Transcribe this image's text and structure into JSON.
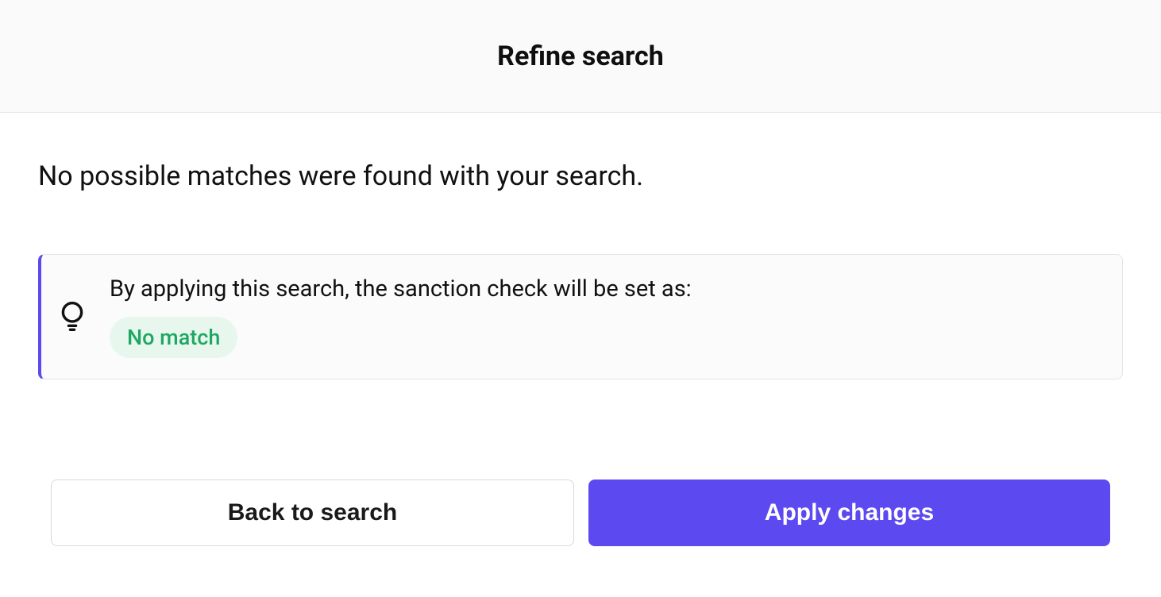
{
  "header": {
    "title": "Refine search"
  },
  "content": {
    "message": "No possible matches were found with your search.",
    "callout": {
      "text": "By applying this search, the sanction check will be set as:",
      "badge_label": "No match",
      "accent_color": "#5c49ef",
      "badge_bg": "#e8f7ee",
      "badge_fg": "#1ea763"
    }
  },
  "footer": {
    "back_label": "Back to search",
    "apply_label": "Apply changes"
  }
}
